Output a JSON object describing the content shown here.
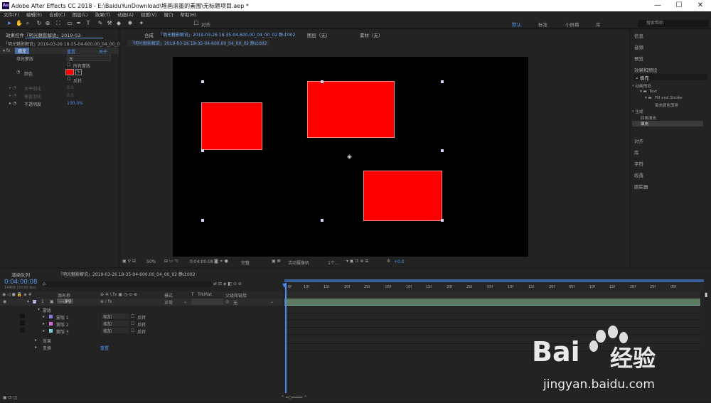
{
  "app": {
    "title": "Adobe After Effects CC 2018 - E:\\BaiduYunDownload\\堆画滚墨的素围\\无标题项目.aep *",
    "logo": "Ae",
    "win_min": "—",
    "win_max": "☐",
    "win_close": "✕"
  },
  "menu": [
    "文件(F)",
    "编辑(E)",
    "合成(C)",
    "图层(L)",
    "效果(T)",
    "动画(A)",
    "视图(V)",
    "窗口",
    "帮助(H)"
  ],
  "toolbar": {
    "align_label": "对齐",
    "workspaces": [
      "默认",
      "标准",
      "小屏幕",
      "库"
    ],
    "active_workspace": "默认",
    "search_placeholder": "搜索帮助"
  },
  "effects_panel": {
    "tab": "效果控件「明光魅影解说」2019-03-",
    "subtitle": "「明光魅影解说」2019-03-26 18-35-04-600.00_04_00_02.",
    "effect_name": "填充",
    "reset": "重置",
    "about": "关于",
    "rows": {
      "mask_label": "填充蒙版",
      "mask_value": "无",
      "all_masks": "所有蒙版",
      "color": "颜色",
      "invert": "反转",
      "h_feather": "水平羽化",
      "h_feather_val": "0.0",
      "v_feather": "垂直羽化",
      "v_feather_val": "0.0",
      "opacity": "不透明度",
      "opacity_val": "100.0%"
    },
    "fill_color": "#ff0000"
  },
  "comp_panel": {
    "tab_prefix": "合成",
    "tab_title": "「明光魅影解说」2019-03-26 18-35-04-600.00_04_00_02 静止002",
    "layer_tab": "图层（无）",
    "footage_tab": "素材（无）",
    "sub_tab": "「明光魅影解说」2019-03-26 18-35-04-600.00_04_00_02 静止002",
    "zoom": "50%",
    "time": "0:04:00:08",
    "quality": "完整",
    "camera": "活动摄像机",
    "views": "1个...",
    "exposure": "+0.0"
  },
  "right_panel": {
    "sections": [
      "信息",
      "音频",
      "预览",
      "效果和预设"
    ],
    "search_value": "填充",
    "tree": {
      "animation_presets": "* 动画预设",
      "text": "Text",
      "fill_stroke": "Fill and Stroke",
      "fill_preset": "填充颜色渐移",
      "generate": "* 生成",
      "gradient_fill": "四角填充",
      "fill": "填充"
    },
    "lower_sections": [
      "对齐",
      "库",
      "字符",
      "段落",
      "跟踪器"
    ]
  },
  "timeline": {
    "render_queue": "渲染队列",
    "tab": "「明光魅影解说」2019-03-26 18-35-04-600.00_04_00_02 静止002",
    "timecode": "0:04:00:08",
    "fps": "14408 (30.00 fps)",
    "search_placeholder": "ρ.",
    "col_name": "源名称",
    "col_mode": "模式",
    "col_t": "T",
    "col_trkmat": "TrkMat",
    "col_parent": "父级和链接",
    "layer_num": "1",
    "layer_name": "....jpg",
    "layer_mode": "正常",
    "layer_parent": "无",
    "masks_label": "蒙版",
    "masks": [
      {
        "name": "蒙版 1",
        "mode": "相加",
        "invert": "反转",
        "color": "#8a7fe0"
      },
      {
        "name": "蒙版 2",
        "mode": "相加",
        "invert": "反转",
        "color": "#d86fd8"
      },
      {
        "name": "蒙版 3",
        "mode": "相加",
        "invert": "反转",
        "color": "#7fd0c8"
      }
    ],
    "effects_label": "效果",
    "transform_label": "变换",
    "transform_reset": "重置",
    "ruler": [
      "0f",
      "10f",
      "15f",
      "20f",
      "25f",
      "05f",
      "10f",
      "15f",
      "20f",
      "25f",
      "05f",
      "10f",
      "15f",
      "20f",
      "05f",
      "10f",
      "15f",
      "20f",
      "25f",
      "05f"
    ]
  },
  "watermark": {
    "brand": "Bai",
    "brand2": "经验",
    "url": "jingyan.baidu.com"
  }
}
